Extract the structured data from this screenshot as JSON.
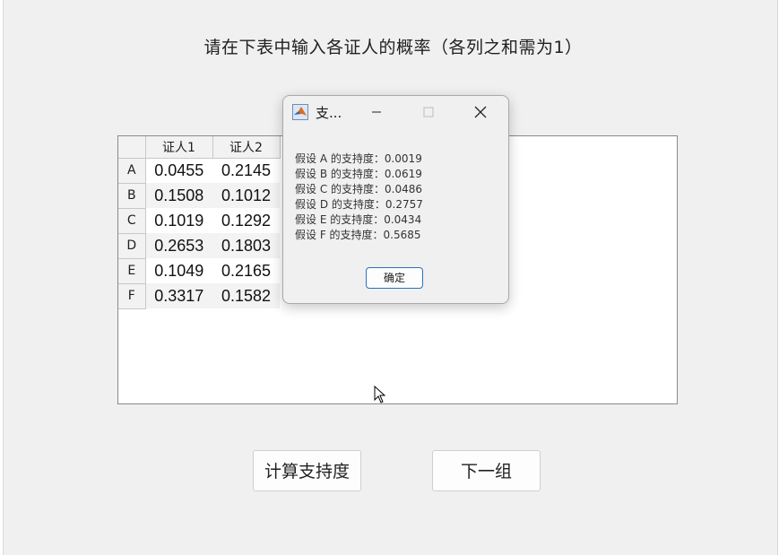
{
  "instruction": "请在下表中输入各证人的概率（各列之和需为1）",
  "table": {
    "columns": [
      "证人1",
      "证人2"
    ],
    "rows": [
      {
        "label": "A",
        "values": [
          "0.0455",
          "0.2145"
        ]
      },
      {
        "label": "B",
        "values": [
          "0.1508",
          "0.1012"
        ]
      },
      {
        "label": "C",
        "values": [
          "0.1019",
          "0.1292"
        ]
      },
      {
        "label": "D",
        "values": [
          "0.2653",
          "0.1803"
        ]
      },
      {
        "label": "E",
        "values": [
          "0.1049",
          "0.2165"
        ]
      },
      {
        "label": "F",
        "values": [
          "0.3317",
          "0.1582"
        ]
      }
    ]
  },
  "buttons": {
    "calculate": "计算支持度",
    "next": "下一组"
  },
  "dialog": {
    "title": "支...",
    "lines": [
      "假设 A 的支持度：0.0019",
      "假设 B 的支持度：0.0619",
      "假设 C 的支持度：0.0486",
      "假设 D 的支持度：0.2757",
      "假设 E 的支持度：0.0434",
      "假设 F 的支持度：0.5685"
    ],
    "ok": "确定",
    "app_icon": "matlab-icon"
  },
  "colors": {
    "dialog_ok_border": "#2b6fc2",
    "window_bg": "#f0f0f0"
  }
}
